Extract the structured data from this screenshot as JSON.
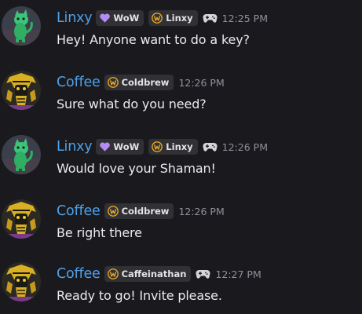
{
  "messages": [
    {
      "avatar_icon": "green-cat-avatar-icon",
      "username": "Linxy",
      "tags": [
        {
          "kind": "wow",
          "icon": "heart-icon",
          "label": "WoW"
        },
        {
          "kind": "guild",
          "icon": "warcraft-w-icon",
          "label": "Linxy"
        }
      ],
      "gamepad_icon": "gamepad-icon",
      "time": "12:25 PM",
      "text": "Hey! Anyone want to do a key?"
    },
    {
      "avatar_icon": "golden-pharaoh-avatar-icon",
      "username": "Coffee",
      "tags": [
        {
          "kind": "guild",
          "icon": "warcraft-w-icon",
          "label": "Coldbrew"
        }
      ],
      "time": "12:26 PM",
      "text": "Sure what do you need?"
    },
    {
      "avatar_icon": "green-cat-avatar-icon",
      "username": "Linxy",
      "tags": [
        {
          "kind": "wow",
          "icon": "heart-icon",
          "label": "WoW"
        },
        {
          "kind": "guild",
          "icon": "warcraft-w-icon",
          "label": "Linxy"
        }
      ],
      "gamepad_icon": "gamepad-icon",
      "time": "12:26 PM",
      "text": "Would love your Shaman!"
    },
    {
      "avatar_icon": "golden-pharaoh-avatar-icon",
      "username": "Coffee",
      "tags": [
        {
          "kind": "guild",
          "icon": "warcraft-w-icon",
          "label": "Coldbrew"
        }
      ],
      "time": "12:26 PM",
      "text": "Be right there"
    },
    {
      "avatar_icon": "golden-pharaoh-avatar-icon",
      "username": "Coffee",
      "tags": [
        {
          "kind": "guild",
          "icon": "warcraft-w-icon",
          "label": "Caffeinathan"
        }
      ],
      "gamepad_icon": "gamepad-icon",
      "time": "12:27 PM",
      "text": "Ready to go! Invite please."
    }
  ],
  "colors": {
    "background": "#1a1a1e",
    "username": "#4ea0e8",
    "message_text": "#eaeaef",
    "timestamp": "#8e9099",
    "tag_background": "#303035",
    "wow_heart": "#b58bf5",
    "warcraft_gold": "#e5a825"
  }
}
